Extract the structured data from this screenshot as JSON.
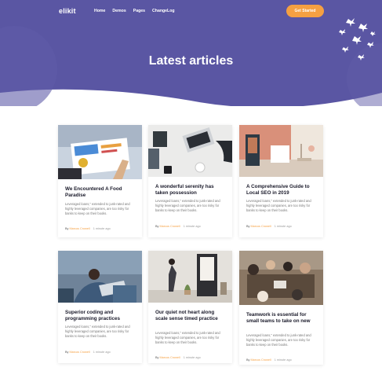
{
  "nav": {
    "logo": "elikit",
    "links": [
      "Home",
      "Demos",
      "Pages",
      "ChangeLog"
    ],
    "cta": "Get Started"
  },
  "hero": {
    "title": "Latest articles"
  },
  "colors": {
    "hero": "#5a56a3",
    "accent": "#f5a042"
  },
  "articles": [
    {
      "title": "We Encountered A Food Paradise",
      "excerpt": "Leveraged loans,\" extended to junk-rated and highly leveraged companies, are too risky for banks to keep on their books.",
      "by": "By",
      "author": "Marcus Crowell",
      "time": "1 minute ago"
    },
    {
      "title": "A wonderful serenity has taken possession",
      "excerpt": "Leveraged loans,\" extended to junk-rated and highly leveraged companies, are too risky for banks to keep on their books.",
      "by": "By",
      "author": "Marcus Crowell",
      "time": "1 minute ago"
    },
    {
      "title": "A Comprehensive Guide to Local SEO in 2019",
      "excerpt": "Leveraged loans,\" extended to junk-rated and highly leveraged companies, are too risky for banks to keep on their books.",
      "by": "By",
      "author": "Marcus Crowell",
      "time": "1 minute ago"
    },
    {
      "title": "Superior coding and programming practices",
      "excerpt": "Leveraged loans,\" extended to junk-rated and highly leveraged companies, are too risky for banks to keep on their books.",
      "by": "By",
      "author": "Marcus Crowell",
      "time": "1 minute ago"
    },
    {
      "title": "Our quiet not heart along scale sense timed practice",
      "excerpt": "Leveraged loans,\" extended to junk-rated and highly leveraged companies, are too risky for banks to keep on their books.",
      "by": "By",
      "author": "Marcus Crowell",
      "time": "1 minute ago"
    },
    {
      "title": "Teamwork is essential for small teams to take on new",
      "excerpt": "Leveraged loans,\" extended to junk-rated and highly leveraged companies, are too risky for banks to keep on their books.",
      "by": "By",
      "author": "Marcus Crowell",
      "time": "1 minute ago"
    }
  ]
}
